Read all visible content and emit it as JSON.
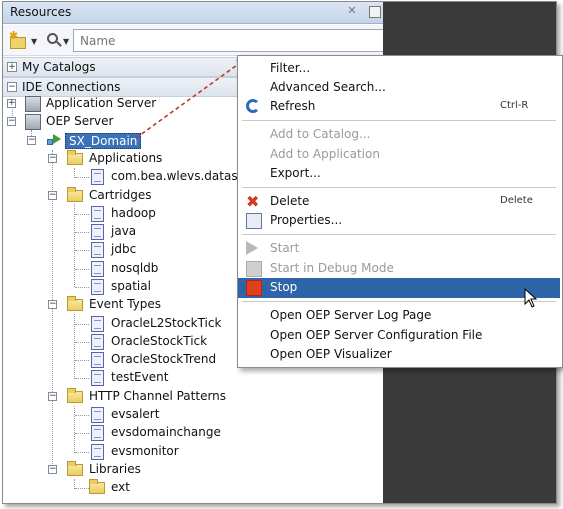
{
  "panel": {
    "title": "Resources",
    "search_placeholder": "Name",
    "sections": {
      "my_catalogs": "My Catalogs",
      "ide_connections": "IDE Connections"
    }
  },
  "tree": {
    "application_server": "Application Server",
    "oep_server": "OEP Server",
    "domain": "SX_Domain",
    "applications": {
      "label": "Applications",
      "children": [
        "com.bea.wlevs.datas"
      ]
    },
    "cartridges": {
      "label": "Cartridges",
      "children": [
        "hadoop",
        "java",
        "jdbc",
        "nosqldb",
        "spatial"
      ]
    },
    "event_types": {
      "label": "Event Types",
      "children": [
        "OracleL2StockTick",
        "OracleStockTick",
        "OracleStockTrend",
        "testEvent"
      ]
    },
    "http_channel_patterns": {
      "label": "HTTP Channel Patterns",
      "children": [
        "evsalert",
        "evsdomainchange",
        "evsmonitor"
      ]
    },
    "libraries": {
      "label": "Libraries",
      "children": [
        "ext"
      ]
    }
  },
  "context_menu": {
    "filter": "Filter...",
    "advanced_search": "Advanced Search...",
    "refresh": "Refresh",
    "refresh_shortcut": "Ctrl-R",
    "add_to_catalog": "Add to Catalog...",
    "add_to_application": "Add to Application",
    "export": "Export...",
    "delete": "Delete",
    "delete_shortcut": "Delete",
    "properties": "Properties...",
    "start": "Start",
    "start_debug": "Start in Debug Mode",
    "stop": "Stop",
    "open_log": "Open OEP Server Log Page",
    "open_config": "Open OEP Server Configuration File",
    "open_visualizer": "Open OEP Visualizer"
  },
  "colors": {
    "selection": "#2f64a8",
    "arrow": "#c0392b"
  }
}
